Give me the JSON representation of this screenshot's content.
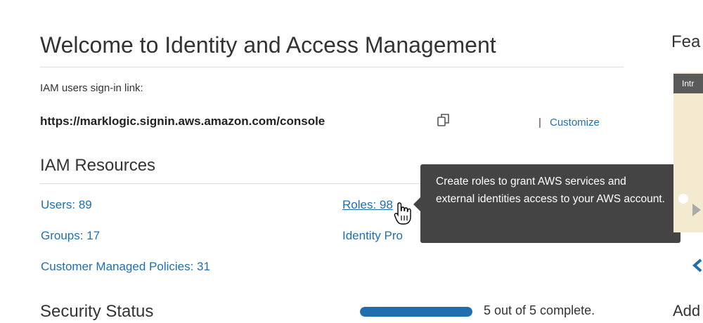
{
  "header": {
    "title": "Welcome to Identity and Access Management"
  },
  "signin": {
    "label": "IAM users sign-in link:",
    "url": "https://marklogic.signin.aws.amazon.com/console",
    "separator": "|",
    "customize_label": "Customize",
    "copy_icon": "copy-icon"
  },
  "resources": {
    "heading": "IAM Resources",
    "users": "Users: 89",
    "groups": "Groups: 17",
    "customer_policies": "Customer Managed Policies: 31",
    "roles": "Roles: 98",
    "identity_providers": "Identity Pro"
  },
  "tooltip": {
    "text": "Create roles to grant AWS services and external identities access to your AWS account."
  },
  "security": {
    "heading": "Security Status",
    "progress_fraction": 1.0,
    "progress_text": "5 out of 5 complete."
  },
  "right_panel": {
    "heading": "Fea",
    "video_title": "Intr",
    "add_heading": "Add"
  },
  "colors": {
    "link": "#1f6fb0",
    "tooltip_bg": "#444444",
    "progress": "#1f6fb0"
  }
}
